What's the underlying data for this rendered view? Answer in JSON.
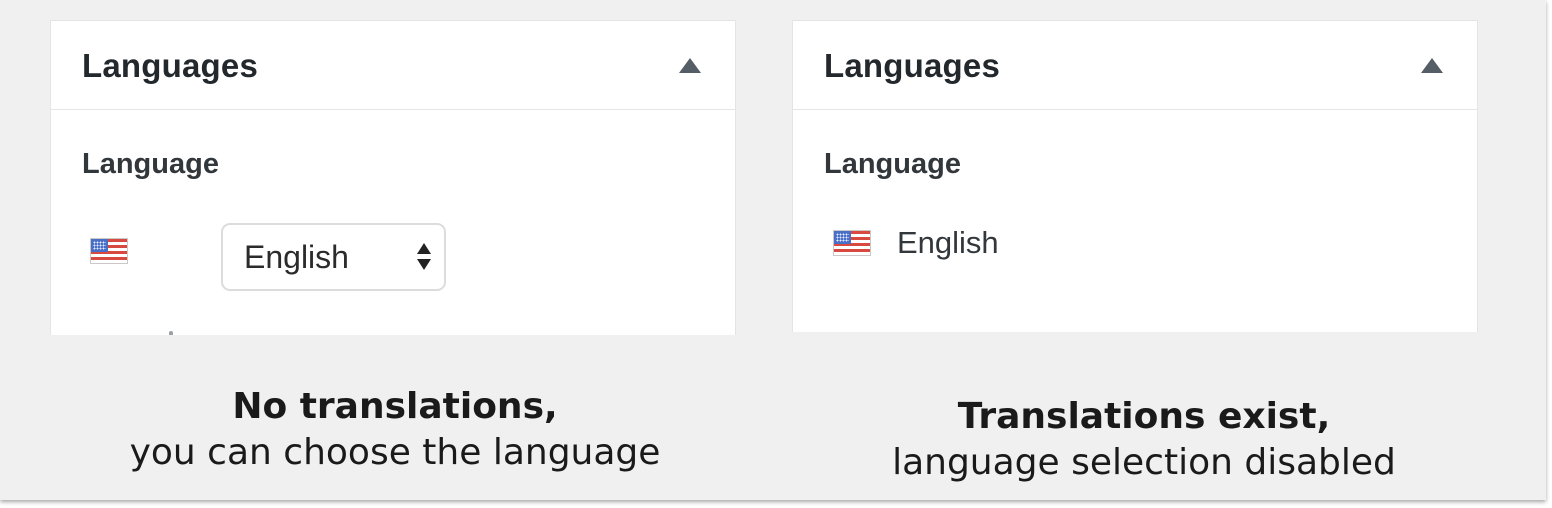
{
  "colors": {
    "background": "#f0f0f0",
    "panel": "#ffffff",
    "title_text": "#23282d",
    "flag_red": "#d84a3f",
    "flag_blue": "#4a6fc7"
  },
  "left_panel": {
    "title": "Languages",
    "toggle_icon": "triangle-up-icon",
    "section_label": "Language",
    "flag_icon": "us-flag-icon",
    "select": {
      "value": "English",
      "icon": "up-down-arrows-icon"
    }
  },
  "right_panel": {
    "title": "Languages",
    "toggle_icon": "triangle-up-icon",
    "section_label": "Language",
    "flag_icon": "us-flag-icon",
    "language": "English"
  },
  "captions": {
    "left": {
      "bold": "No translations,",
      "normal": "you can choose the language"
    },
    "right": {
      "bold": "Translations exist,",
      "normal": "language selection disabled"
    }
  }
}
